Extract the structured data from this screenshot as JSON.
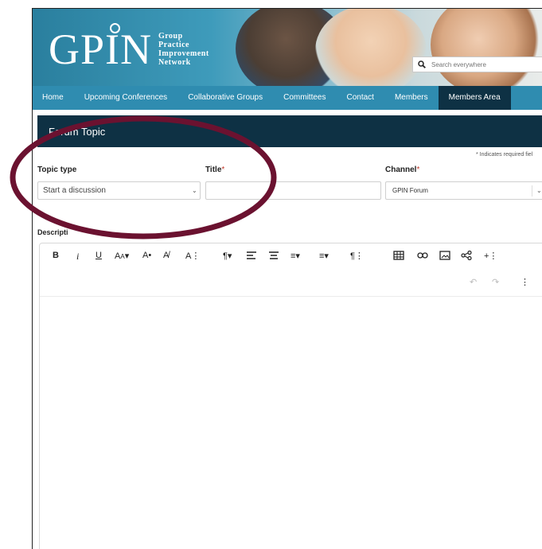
{
  "brand": {
    "logo_text": "GPIN",
    "logo_lines": [
      "Group",
      "Practice",
      "Improvement",
      "Network"
    ]
  },
  "search": {
    "placeholder": "Search everywhere"
  },
  "nav": {
    "items": [
      {
        "label": "Home"
      },
      {
        "label": "Upcoming Conferences"
      },
      {
        "label": "Collaborative Groups"
      },
      {
        "label": "Committees"
      },
      {
        "label": "Contact"
      },
      {
        "label": "Members"
      },
      {
        "label": "Members Area"
      }
    ],
    "active": "Members Area"
  },
  "page": {
    "title": "Forum Topic",
    "required_note": "* Indicates required fiel"
  },
  "form": {
    "topic_type": {
      "label": "Topic type",
      "value": "Start a discussion"
    },
    "title": {
      "label": "Title",
      "required_mark": "*",
      "value": ""
    },
    "channel": {
      "label": "Channel",
      "required_mark": "*",
      "value": "GPIN Forum"
    },
    "description_label": "Descripti"
  },
  "editor_toolbar": [
    "bold-icon",
    "italic-icon",
    "underline-icon",
    "font-size-icon",
    "text-color-icon",
    "clear-format-icon",
    "more-text-icon",
    "paragraph-format-icon",
    "align-left-icon",
    "align-center-icon",
    "ordered-list-icon",
    "unordered-list-icon",
    "more-paragraph-icon",
    "table-icon",
    "link-icon",
    "image-icon",
    "share-icon",
    "more-insert-icon",
    "undo-icon",
    "redo-icon",
    "more-options-icon"
  ],
  "colors": {
    "nav": "#2f8cb0",
    "header_bar": "#0e3144",
    "active_nav": "#0e3144",
    "annotation_oval": "#6b1230",
    "required_star": "#c0392b"
  }
}
